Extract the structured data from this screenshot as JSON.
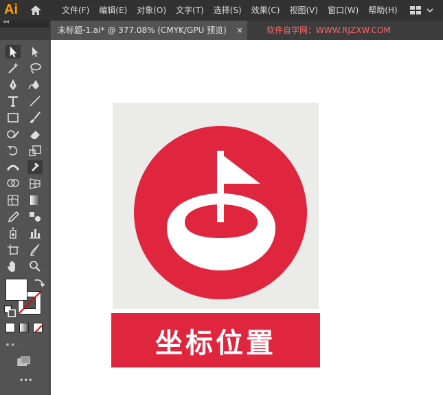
{
  "app": {
    "logo": "Ai",
    "menus": [
      "文件(F)",
      "编辑(E)",
      "对象(O)",
      "文字(T)",
      "选择(S)",
      "效果(C)",
      "视图(V)",
      "窗口(W)",
      "帮助(H)"
    ]
  },
  "tab": {
    "title": "未标题-1.ai* @ 377.08% (CMYK/GPU 预览)",
    "close": "×"
  },
  "watermark": "软件自学网：WWW.RJZXW.COM",
  "panel_collapse": "◂◂",
  "more_tools": "•••",
  "artwork": {
    "label": "坐标位置",
    "colors": {
      "red": "#e0263f",
      "light_gray": "#ebebe9",
      "white": "#ffffff"
    }
  },
  "tools": [
    "selection-tool-icon",
    "direct-selection-tool-icon",
    "magic-wand-tool-icon",
    "lasso-tool-icon",
    "pen-tool-icon",
    "curvature-tool-icon",
    "type-tool-icon",
    "line-segment-tool-icon",
    "rectangle-tool-icon",
    "paintbrush-tool-icon",
    "shaper-tool-icon",
    "eraser-tool-icon",
    "rotate-tool-icon",
    "scale-tool-icon",
    "width-tool-icon",
    "puppet-warp-tool-icon",
    "shape-builder-tool-icon",
    "perspective-grid-tool-icon",
    "mesh-tool-icon",
    "gradient-tool-icon",
    "eyedropper-tool-icon",
    "blend-tool-icon",
    "symbol-sprayer-tool-icon",
    "column-graph-tool-icon",
    "artboard-tool-icon",
    "slice-tool-icon",
    "hand-tool-icon",
    "zoom-tool-icon"
  ]
}
